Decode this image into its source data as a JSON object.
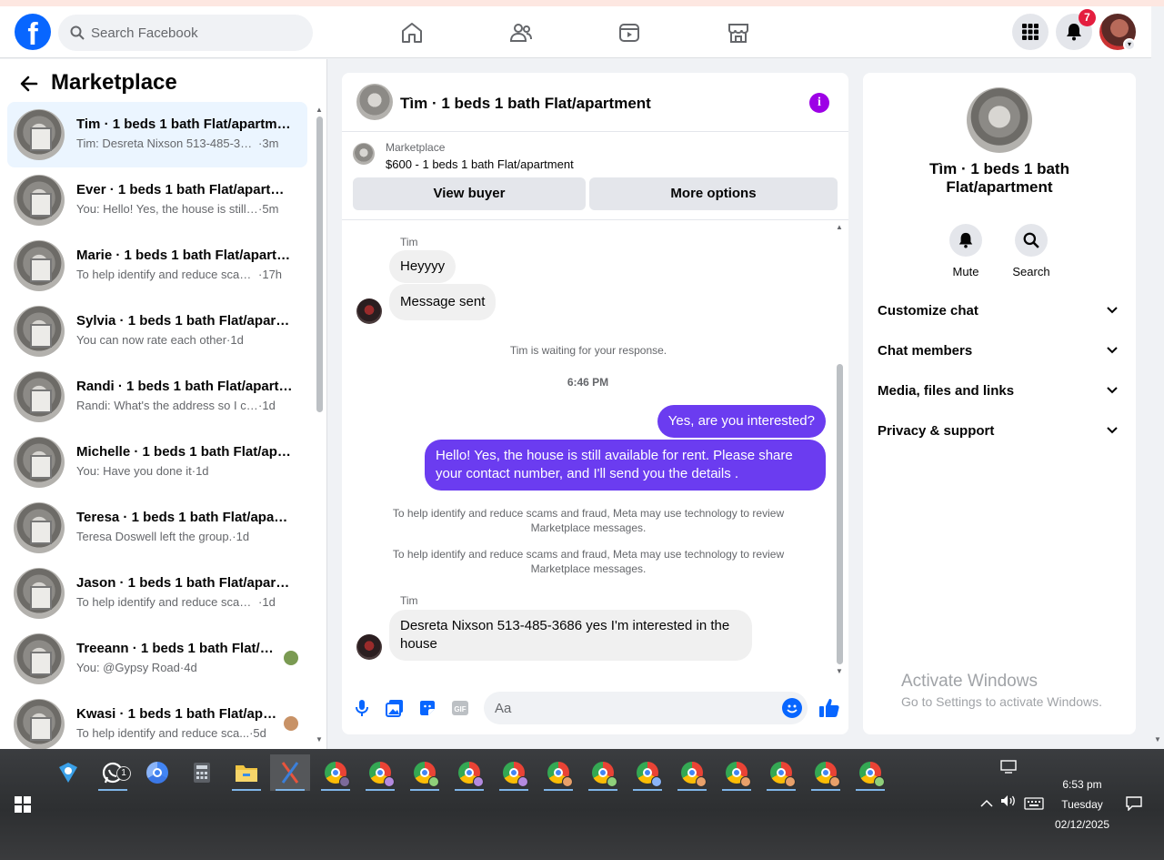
{
  "header": {
    "search_placeholder": "Search Facebook",
    "notification_count": "7"
  },
  "sidebar": {
    "title": "Marketplace",
    "conversations": [
      {
        "name": "Tim · 1 beds 1 bath Flat/apartment",
        "preview": "Tim: Desreta Nixson 513-485-3686...",
        "time": "3m",
        "active": true
      },
      {
        "name": "Ever · 1 beds 1 bath Flat/apartment",
        "preview": "You: Hello! Yes, the house is still av...",
        "time": "5m"
      },
      {
        "name": "Marie · 1 beds 1 bath Flat/apartment",
        "preview": "To help identify and reduce scams...",
        "time": "17h"
      },
      {
        "name": "Sylvia · 1 beds 1 bath Flat/apartment",
        "preview": "You can now rate each other",
        "time": "1d"
      },
      {
        "name": "Randi · 1 beds 1 bath Flat/apartment",
        "preview": "Randi: What's the address so I can ...",
        "time": "1d"
      },
      {
        "name": "Michelle · 1 beds 1 bath Flat/apartment",
        "preview": "You: Have you done it",
        "time": "1d"
      },
      {
        "name": "Teresa · 1 beds 1 bath Flat/apartment",
        "preview": "Teresa Doswell left the group.",
        "time": "1d"
      },
      {
        "name": "Jason · 1 beds 1 bath Flat/apartment",
        "preview": "To help identify and reduce scams ...",
        "time": "1d"
      },
      {
        "name": "Treeann · 1 beds 1 bath Flat/apartment",
        "preview": "You: @Gypsy Road",
        "time": "4d"
      },
      {
        "name": "Kwasi · 1 beds 1 bath Flat/apartment",
        "preview": "To help identify and reduce sca...",
        "time": "5d"
      }
    ]
  },
  "chat": {
    "title": "Tìm · 1 beds 1 bath Flat/apartment",
    "listing_source": "Marketplace",
    "listing_price": "$600 - 1 beds 1 bath Flat/apartment",
    "view_buyer": "View buyer",
    "more_options": "More options",
    "sender_name": "Tim",
    "msg1": "Heyyyy",
    "msg2": "Message sent",
    "waiting": "Tim is waiting for your response.",
    "time": "6:46 PM",
    "out1": "Yes, are you interested?",
    "out2": "Hello! Yes, the house is still available for rent. Please share your contact number, and I'll send you the details .",
    "notice1": "To help identify and reduce scams and fraud, Meta may use technology to review Marketplace messages.",
    "notice2": "To help identify and reduce scams and fraud, Meta may use technology to review Marketplace messages.",
    "msg3": "Desreta Nixson 513-485-3686 yes I'm interested in the house",
    "input_placeholder": "Aa"
  },
  "details": {
    "title": "Tìm · 1 beds 1 bath Flat/apartment",
    "mute": "Mute",
    "search": "Search",
    "sections": [
      "Customize chat",
      "Chat members",
      "Media, files and links",
      "Privacy & support"
    ],
    "watermark_title": "Activate Windows",
    "watermark_sub": "Go to Settings to activate Windows."
  },
  "taskbar": {
    "whatsapp_badge": "1",
    "time": "6:53 pm",
    "day": "Tuesday",
    "date": "02/12/2025"
  },
  "colors": {
    "brand": "#0866ff",
    "outgoing_bubble": "#6b3cf0",
    "info_icon": "#9d00e6"
  }
}
